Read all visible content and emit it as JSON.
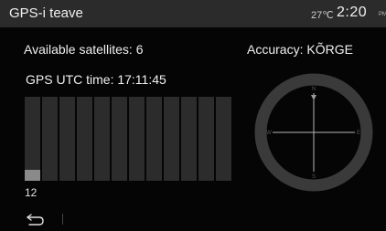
{
  "header": {
    "title": "GPS-i teave",
    "temperature": "27℃",
    "time": "2:20",
    "ampm": "PM"
  },
  "info": {
    "satellites_label": "Available satellites: 6",
    "accuracy_label": "Accuracy: KÕRGE",
    "utc_label": "GPS UTC time: 17:11:45"
  },
  "signal": {
    "bars": [
      {
        "label": "12",
        "level": 0.13
      },
      {
        "label": "",
        "level": 0
      },
      {
        "label": "",
        "level": 0
      },
      {
        "label": "",
        "level": 0
      },
      {
        "label": "",
        "level": 0
      },
      {
        "label": "",
        "level": 0
      },
      {
        "label": "",
        "level": 0
      },
      {
        "label": "",
        "level": 0
      },
      {
        "label": "",
        "level": 0
      },
      {
        "label": "",
        "level": 0
      },
      {
        "label": "",
        "level": 0
      },
      {
        "label": "",
        "level": 0
      }
    ],
    "first_label": "12"
  },
  "compass": {
    "north": "N",
    "east": "E",
    "south": "S",
    "west": "W"
  },
  "footer": {
    "back_icon": "back-arrow-icon"
  }
}
